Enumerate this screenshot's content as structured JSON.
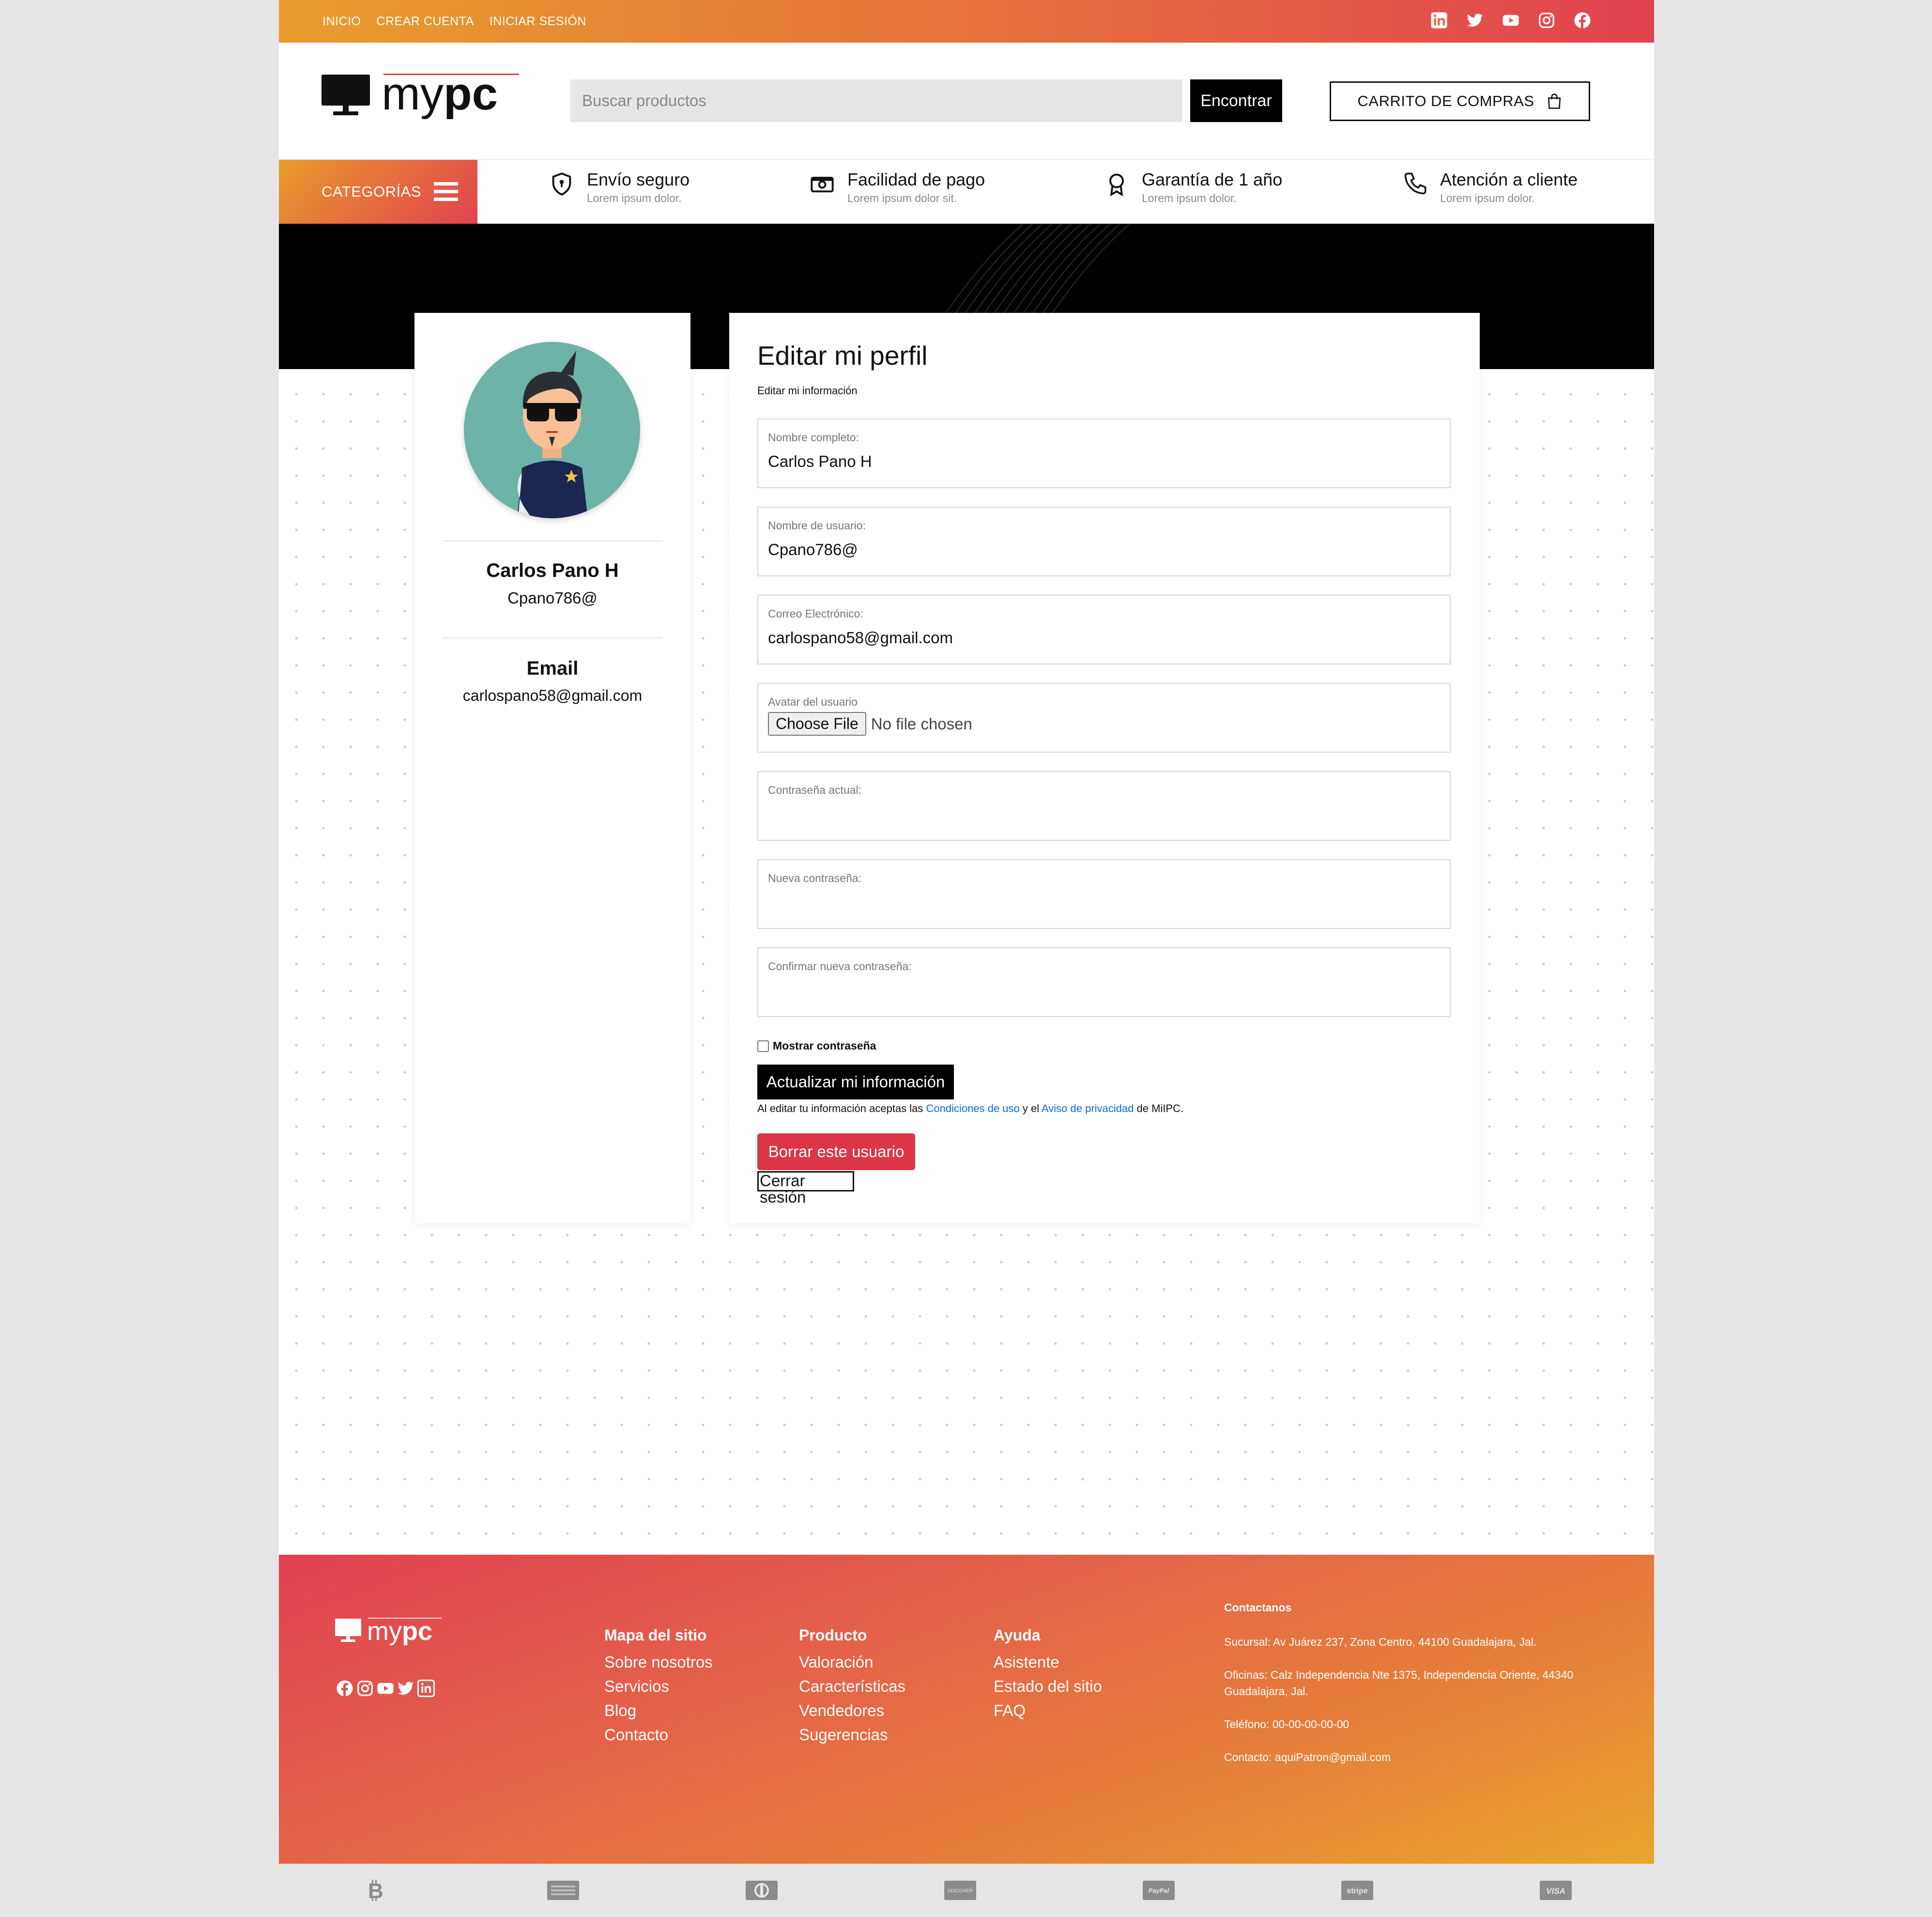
{
  "topbar": {
    "links": [
      "INICIO",
      "CREAR CUENTA",
      "INICIAR SESIÓN"
    ],
    "social_icons": [
      "linkedin-icon",
      "twitter-icon",
      "youtube-icon",
      "instagram-icon",
      "facebook-icon"
    ]
  },
  "header": {
    "logo_text_light": "my",
    "logo_text_bold": "pc",
    "search_placeholder": "Buscar productos",
    "search_button": "Encontrar",
    "cart_button": "CARRITO DE COMPRAS"
  },
  "features": {
    "categories_label": "CATEGORÍAS",
    "items": [
      {
        "icon": "shield-icon",
        "title": "Envío seguro",
        "subtitle": "Lorem ipsum dolor."
      },
      {
        "icon": "money-icon",
        "title": "Facilidad de pago",
        "subtitle": "Lorem ipsum dolor sit."
      },
      {
        "icon": "award-icon",
        "title": "Garantía de 1 año",
        "subtitle": "Lorem ipsum dolor."
      },
      {
        "icon": "phone-icon",
        "title": "Atención a cliente",
        "subtitle": "Lorem ipsum dolor."
      }
    ]
  },
  "profile": {
    "name": "Carlos Pano H",
    "username": "Cpano786@",
    "email_heading": "Email",
    "email": "carlospano58@gmail.com"
  },
  "edit": {
    "title": "Editar mi perfil",
    "subtitle": "Editar mi información",
    "fields": [
      {
        "label": "Nombre completo:",
        "value": "Carlos Pano H"
      },
      {
        "label": "Nombre de usuario:",
        "value": "Cpano786@"
      },
      {
        "label": "Correo Electrónico:",
        "value": "carlospano58@gmail.com"
      },
      {
        "label": "Avatar del usuario",
        "file_button": "Choose File",
        "file_status": "No file chosen"
      },
      {
        "label": "Contraseña actual:",
        "value": ""
      },
      {
        "label": "Nueva contraseña:",
        "value": ""
      },
      {
        "label": "Confirmar nueva contraseña:",
        "value": ""
      }
    ],
    "show_password": "Mostrar contraseña",
    "update_button": "Actualizar mi información",
    "terms_prefix": "Al editar tu información aceptas las ",
    "terms_link1": "Condiciones de uso",
    "terms_mid": " y el ",
    "terms_link2": "Aviso de privacidad",
    "terms_suffix": " de MiIPC.",
    "delete_button": "Borrar este usuario",
    "logout_button": "Cerrar sesión"
  },
  "footer": {
    "columns": [
      {
        "heading": "Mapa del sitio",
        "items": [
          "Sobre nosotros",
          "Servicios",
          "Blog",
          "Contacto"
        ]
      },
      {
        "heading": "Producto",
        "items": [
          "Valoración",
          "Características",
          "Vendedores",
          "Sugerencias"
        ]
      },
      {
        "heading": "Ayuda",
        "items": [
          "Asistente",
          "Estado del sitio",
          "FAQ"
        ]
      }
    ],
    "contact": {
      "heading": "Contactanos",
      "lines": [
        "Sucursal: Av Juárez 237, Zona Centro, 44100 Guadalajara, Jal.",
        "Oficinas: Calz Independencia Nte 1375, Independencia Oriente, 44340 Guadalajara, Jal.",
        "Teléfono: 00-00-00-00-00",
        "Contacto: aquiPatron@gmail.com"
      ]
    }
  },
  "payments": [
    "bitcoin-icon",
    "amex-icon",
    "diners-icon",
    "discover-icon",
    "paypal-icon",
    "stripe-icon",
    "visa-icon"
  ],
  "payment_labels": {
    "discover": "DISCOVER",
    "paypal": "PayPal",
    "stripe": "stripe",
    "visa": "VISA"
  },
  "colors": {
    "accent_orange": "#e89d2c",
    "accent_red": "#e1434f",
    "delete_red": "#dc3545",
    "link_blue": "#0b6ad8"
  }
}
